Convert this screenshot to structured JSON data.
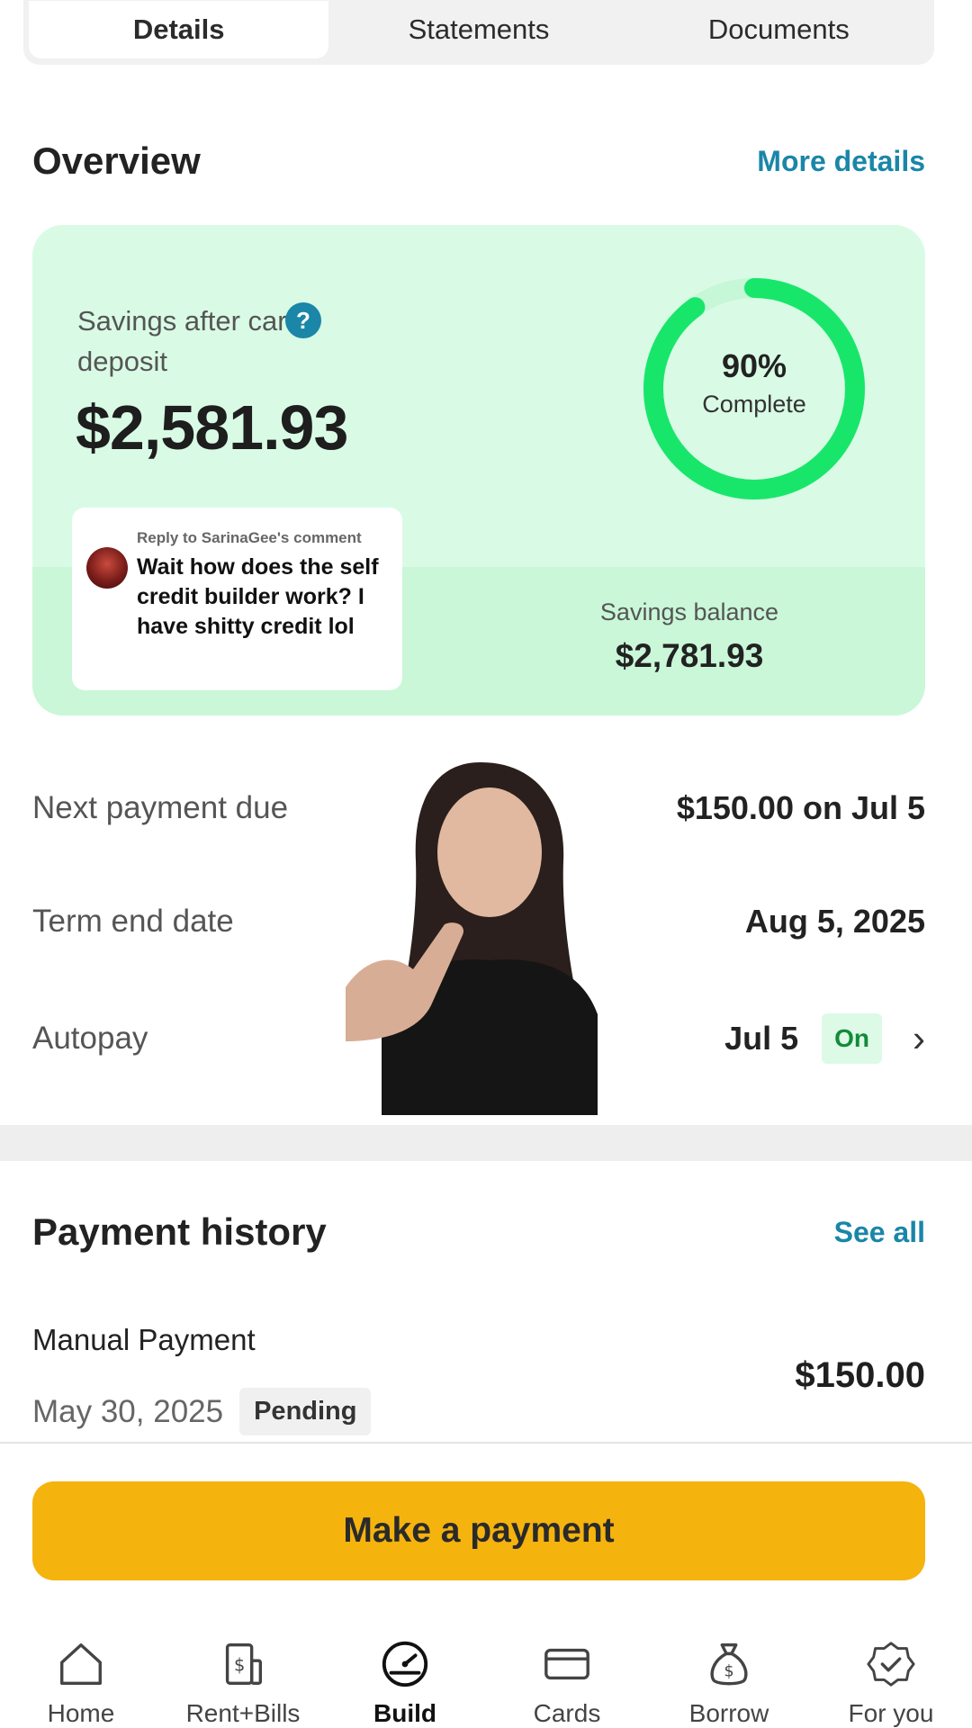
{
  "tabs": [
    {
      "label": "Details",
      "active": true
    },
    {
      "label": "Statements",
      "active": false
    },
    {
      "label": "Documents",
      "active": false
    }
  ],
  "overview": {
    "title": "Overview",
    "link": "More details",
    "savings_label": "Savings after card deposit",
    "help_icon": "?",
    "savings_amount": "$2,581.93",
    "progress_percent": 90,
    "progress_text": "90%",
    "progress_sub": "Complete",
    "balance_label": "Savings balance",
    "balance_value": "$2,781.93"
  },
  "comment": {
    "reply_to": "Reply to SarinaGee's comment",
    "text": "Wait how does the self credit builder work? I have shitty credit lol"
  },
  "details": {
    "next_payment_label": "Next payment due",
    "next_payment_value": "$150.00 on Jul 5",
    "term_end_label": "Term end date",
    "term_end_value": "Aug 5, 2025",
    "autopay_label": "Autopay",
    "autopay_date": "Jul 5",
    "autopay_status": "On"
  },
  "payment_history": {
    "title": "Payment history",
    "link": "See all",
    "items": [
      {
        "title": "Manual Payment",
        "date": "May 30, 2025",
        "status": "Pending",
        "amount": "$150.00"
      }
    ]
  },
  "make_payment_label": "Make a payment",
  "nav": [
    {
      "label": "Home",
      "icon": "home-icon"
    },
    {
      "label": "Rent+Bills",
      "icon": "bill-icon"
    },
    {
      "label": "Build",
      "icon": "gauge-icon",
      "active": true
    },
    {
      "label": "Cards",
      "icon": "card-icon"
    },
    {
      "label": "Borrow",
      "icon": "money-bag-icon"
    },
    {
      "label": "For you",
      "icon": "badge-check-icon"
    }
  ],
  "colors": {
    "accent_link": "#1a86a8",
    "progress_green": "#18e66b",
    "button_yellow": "#f5b30e",
    "card_bg": "#d9fbe5"
  }
}
